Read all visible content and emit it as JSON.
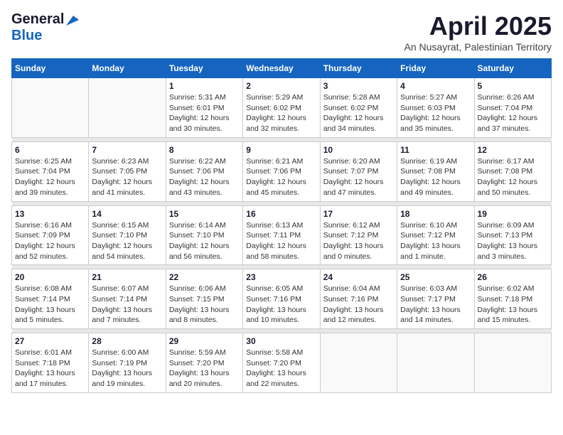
{
  "header": {
    "logo_general": "General",
    "logo_blue": "Blue",
    "month": "April 2025",
    "location": "An Nusayrat, Palestinian Territory"
  },
  "calendar": {
    "days_of_week": [
      "Sunday",
      "Monday",
      "Tuesday",
      "Wednesday",
      "Thursday",
      "Friday",
      "Saturday"
    ],
    "weeks": [
      {
        "days": [
          {
            "date": "",
            "info": ""
          },
          {
            "date": "",
            "info": ""
          },
          {
            "date": "1",
            "info": "Sunrise: 5:31 AM\nSunset: 6:01 PM\nDaylight: 12 hours\nand 30 minutes."
          },
          {
            "date": "2",
            "info": "Sunrise: 5:29 AM\nSunset: 6:02 PM\nDaylight: 12 hours\nand 32 minutes."
          },
          {
            "date": "3",
            "info": "Sunrise: 5:28 AM\nSunset: 6:02 PM\nDaylight: 12 hours\nand 34 minutes."
          },
          {
            "date": "4",
            "info": "Sunrise: 5:27 AM\nSunset: 6:03 PM\nDaylight: 12 hours\nand 35 minutes."
          },
          {
            "date": "5",
            "info": "Sunrise: 6:26 AM\nSunset: 7:04 PM\nDaylight: 12 hours\nand 37 minutes."
          }
        ]
      },
      {
        "days": [
          {
            "date": "6",
            "info": "Sunrise: 6:25 AM\nSunset: 7:04 PM\nDaylight: 12 hours\nand 39 minutes."
          },
          {
            "date": "7",
            "info": "Sunrise: 6:23 AM\nSunset: 7:05 PM\nDaylight: 12 hours\nand 41 minutes."
          },
          {
            "date": "8",
            "info": "Sunrise: 6:22 AM\nSunset: 7:06 PM\nDaylight: 12 hours\nand 43 minutes."
          },
          {
            "date": "9",
            "info": "Sunrise: 6:21 AM\nSunset: 7:06 PM\nDaylight: 12 hours\nand 45 minutes."
          },
          {
            "date": "10",
            "info": "Sunrise: 6:20 AM\nSunset: 7:07 PM\nDaylight: 12 hours\nand 47 minutes."
          },
          {
            "date": "11",
            "info": "Sunrise: 6:19 AM\nSunset: 7:08 PM\nDaylight: 12 hours\nand 49 minutes."
          },
          {
            "date": "12",
            "info": "Sunrise: 6:17 AM\nSunset: 7:08 PM\nDaylight: 12 hours\nand 50 minutes."
          }
        ]
      },
      {
        "days": [
          {
            "date": "13",
            "info": "Sunrise: 6:16 AM\nSunset: 7:09 PM\nDaylight: 12 hours\nand 52 minutes."
          },
          {
            "date": "14",
            "info": "Sunrise: 6:15 AM\nSunset: 7:10 PM\nDaylight: 12 hours\nand 54 minutes."
          },
          {
            "date": "15",
            "info": "Sunrise: 6:14 AM\nSunset: 7:10 PM\nDaylight: 12 hours\nand 56 minutes."
          },
          {
            "date": "16",
            "info": "Sunrise: 6:13 AM\nSunset: 7:11 PM\nDaylight: 12 hours\nand 58 minutes."
          },
          {
            "date": "17",
            "info": "Sunrise: 6:12 AM\nSunset: 7:12 PM\nDaylight: 13 hours\nand 0 minutes."
          },
          {
            "date": "18",
            "info": "Sunrise: 6:10 AM\nSunset: 7:12 PM\nDaylight: 13 hours\nand 1 minute."
          },
          {
            "date": "19",
            "info": "Sunrise: 6:09 AM\nSunset: 7:13 PM\nDaylight: 13 hours\nand 3 minutes."
          }
        ]
      },
      {
        "days": [
          {
            "date": "20",
            "info": "Sunrise: 6:08 AM\nSunset: 7:14 PM\nDaylight: 13 hours\nand 5 minutes."
          },
          {
            "date": "21",
            "info": "Sunrise: 6:07 AM\nSunset: 7:14 PM\nDaylight: 13 hours\nand 7 minutes."
          },
          {
            "date": "22",
            "info": "Sunrise: 6:06 AM\nSunset: 7:15 PM\nDaylight: 13 hours\nand 8 minutes."
          },
          {
            "date": "23",
            "info": "Sunrise: 6:05 AM\nSunset: 7:16 PM\nDaylight: 13 hours\nand 10 minutes."
          },
          {
            "date": "24",
            "info": "Sunrise: 6:04 AM\nSunset: 7:16 PM\nDaylight: 13 hours\nand 12 minutes."
          },
          {
            "date": "25",
            "info": "Sunrise: 6:03 AM\nSunset: 7:17 PM\nDaylight: 13 hours\nand 14 minutes."
          },
          {
            "date": "26",
            "info": "Sunrise: 6:02 AM\nSunset: 7:18 PM\nDaylight: 13 hours\nand 15 minutes."
          }
        ]
      },
      {
        "days": [
          {
            "date": "27",
            "info": "Sunrise: 6:01 AM\nSunset: 7:18 PM\nDaylight: 13 hours\nand 17 minutes."
          },
          {
            "date": "28",
            "info": "Sunrise: 6:00 AM\nSunset: 7:19 PM\nDaylight: 13 hours\nand 19 minutes."
          },
          {
            "date": "29",
            "info": "Sunrise: 5:59 AM\nSunset: 7:20 PM\nDaylight: 13 hours\nand 20 minutes."
          },
          {
            "date": "30",
            "info": "Sunrise: 5:58 AM\nSunset: 7:20 PM\nDaylight: 13 hours\nand 22 minutes."
          },
          {
            "date": "",
            "info": ""
          },
          {
            "date": "",
            "info": ""
          },
          {
            "date": "",
            "info": ""
          }
        ]
      }
    ]
  }
}
